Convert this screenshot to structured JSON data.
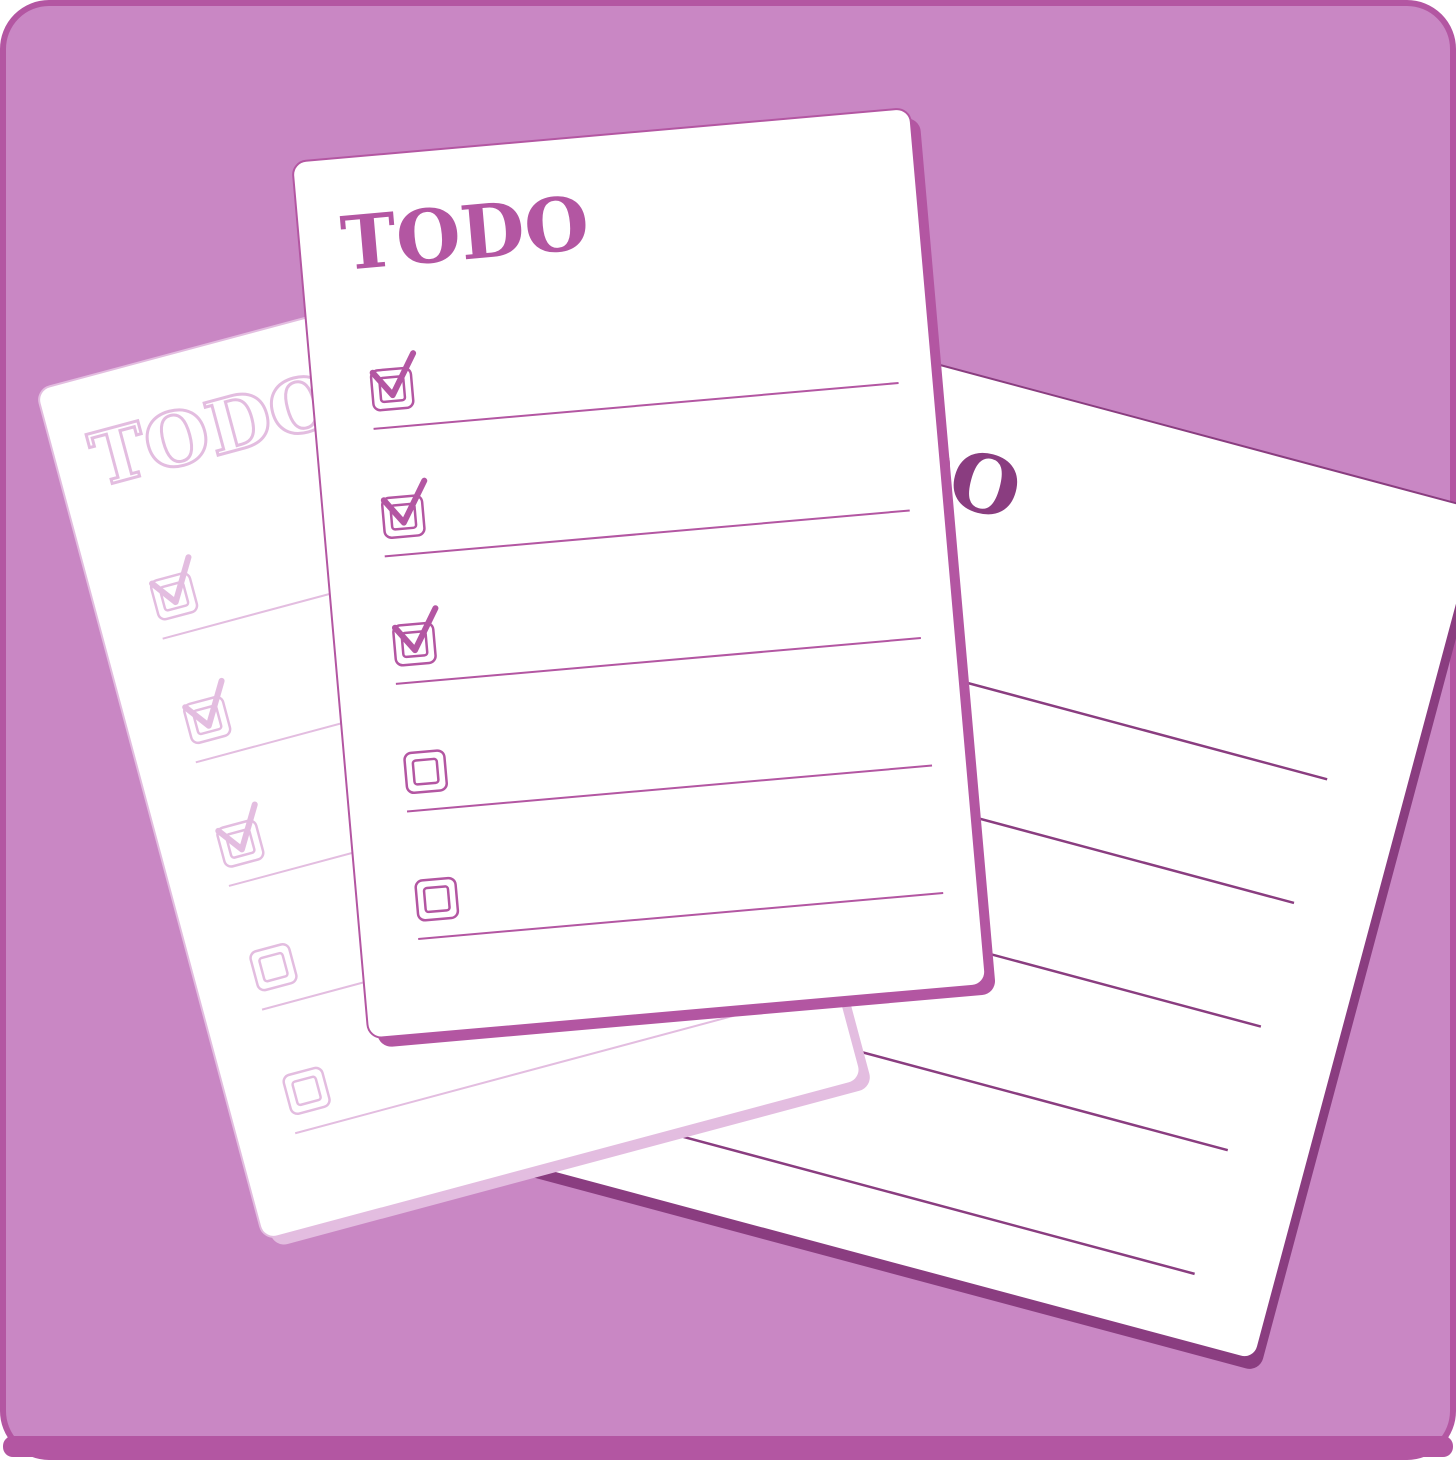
{
  "colors": {
    "background": "#c987c4",
    "frame_border": "#b356a2",
    "paper": "#ffffff",
    "accent": "#b356a2",
    "accent_dark": "#8a3d80",
    "accent_faded": "#e3bde0"
  },
  "sheets": {
    "back_left": {
      "title": "TODO",
      "items": [
        {
          "checked": true
        },
        {
          "checked": true
        },
        {
          "checked": true
        },
        {
          "checked": false
        },
        {
          "checked": false
        }
      ]
    },
    "back_right": {
      "title": "TODO"
    },
    "front": {
      "title": "TODO",
      "items": [
        {
          "checked": true
        },
        {
          "checked": true
        },
        {
          "checked": true
        },
        {
          "checked": false
        },
        {
          "checked": false
        }
      ]
    }
  },
  "icons": {
    "checkbox_checked": "checkbox-checked-icon",
    "checkbox_empty": "checkbox-empty-icon"
  }
}
